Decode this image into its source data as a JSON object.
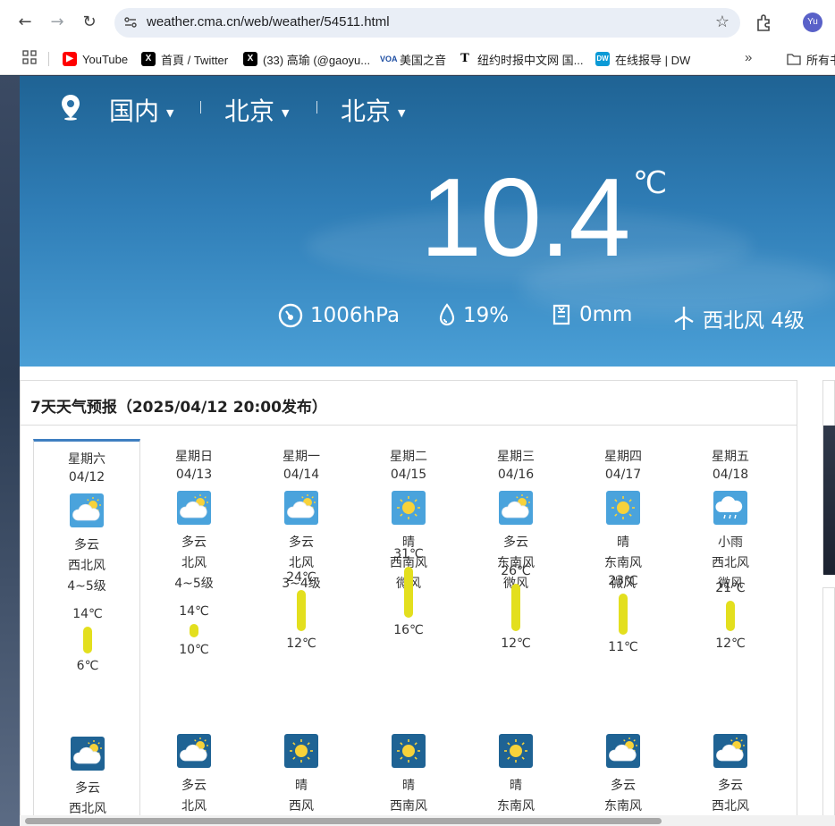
{
  "browser": {
    "url": "weather.cma.cn/web/weather/54511.html",
    "profile_initials": "Yu"
  },
  "bookmarks": [
    {
      "label": "YouTube",
      "icon": "youtube-icon",
      "color": "#ff0000"
    },
    {
      "label": "首頁 / Twitter",
      "icon": "x-icon",
      "color": "#000000"
    },
    {
      "label": "(33) 高瑜 (@gaoyu...",
      "icon": "x-icon",
      "color": "#000000"
    },
    {
      "label": "美国之音",
      "icon": "voa-icon",
      "color": "#1f4fa3"
    },
    {
      "label": "纽约时报中文网 国...",
      "icon": "nyt-icon",
      "color": "#000000"
    },
    {
      "label": "在线报导 | DW",
      "icon": "dw-icon",
      "color": "#0b9ad6"
    }
  ],
  "bookmarks_folder": "所有书",
  "location": {
    "region": "国内",
    "province": "北京",
    "city": "北京"
  },
  "current": {
    "temperature": "10.4",
    "unit": "℃",
    "pressure": "1006hPa",
    "humidity": "19%",
    "precipitation": "0mm",
    "wind": "西北风 4级"
  },
  "forecast": {
    "title": "7天天气预报（2025/04/12 20:00发布）",
    "days": [
      {
        "weekday": "星期六",
        "date": "04/12",
        "day_icon": "partly-cloudy-icon",
        "day_weather": "多云",
        "day_wind_dir": "西北风",
        "day_wind_level": "4~5级",
        "high": "14℃",
        "low": "6℃",
        "high_value": 14,
        "low_value": 6,
        "night_icon": "partly-cloudy-night-icon",
        "night_weather": "多云",
        "night_wind_dir": "西北风"
      },
      {
        "weekday": "星期日",
        "date": "04/13",
        "day_icon": "partly-cloudy-icon",
        "day_weather": "多云",
        "day_wind_dir": "北风",
        "day_wind_level": "4~5级",
        "high": "14℃",
        "low": "10℃",
        "high_value": 14,
        "low_value": 10,
        "night_icon": "partly-cloudy-night-icon",
        "night_weather": "多云",
        "night_wind_dir": "北风"
      },
      {
        "weekday": "星期一",
        "date": "04/14",
        "day_icon": "partly-cloudy-icon",
        "day_weather": "多云",
        "day_wind_dir": "北风",
        "day_wind_level": "3~4级",
        "high": "24℃",
        "low": "12℃",
        "high_value": 24,
        "low_value": 12,
        "night_icon": "sunny-night-icon",
        "night_weather": "晴",
        "night_wind_dir": "西风"
      },
      {
        "weekday": "星期二",
        "date": "04/15",
        "day_icon": "sunny-icon",
        "day_weather": "晴",
        "day_wind_dir": "西南风",
        "day_wind_level": "微风",
        "high": "31℃",
        "low": "16℃",
        "high_value": 31,
        "low_value": 16,
        "night_icon": "sunny-night-icon",
        "night_weather": "晴",
        "night_wind_dir": "西南风"
      },
      {
        "weekday": "星期三",
        "date": "04/16",
        "day_icon": "partly-cloudy-icon",
        "day_weather": "多云",
        "day_wind_dir": "东南风",
        "day_wind_level": "微风",
        "high": "26℃",
        "low": "12℃",
        "high_value": 26,
        "low_value": 12,
        "night_icon": "sunny-night-icon",
        "night_weather": "晴",
        "night_wind_dir": "东南风"
      },
      {
        "weekday": "星期四",
        "date": "04/17",
        "day_icon": "sunny-icon",
        "day_weather": "晴",
        "day_wind_dir": "东南风",
        "day_wind_level": "微风",
        "high": "23℃",
        "low": "11℃",
        "high_value": 23,
        "low_value": 11,
        "night_icon": "partly-cloudy-night-icon",
        "night_weather": "多云",
        "night_wind_dir": "东南风"
      },
      {
        "weekday": "星期五",
        "date": "04/18",
        "day_icon": "light-rain-icon",
        "day_weather": "小雨",
        "day_wind_dir": "西北风",
        "day_wind_level": "微风",
        "high": "21℃",
        "low": "12℃",
        "high_value": 21,
        "low_value": 12,
        "night_icon": "partly-cloudy-night-icon",
        "night_weather": "多云",
        "night_wind_dir": "西北风"
      }
    ]
  },
  "colors": {
    "temp_bar": "#e3df1e",
    "active_tab": "#3f7fc1",
    "day_icon_bg": "#4aa3dc",
    "night_icon_bg": "#1f6394",
    "sun": "#f7d23a"
  }
}
